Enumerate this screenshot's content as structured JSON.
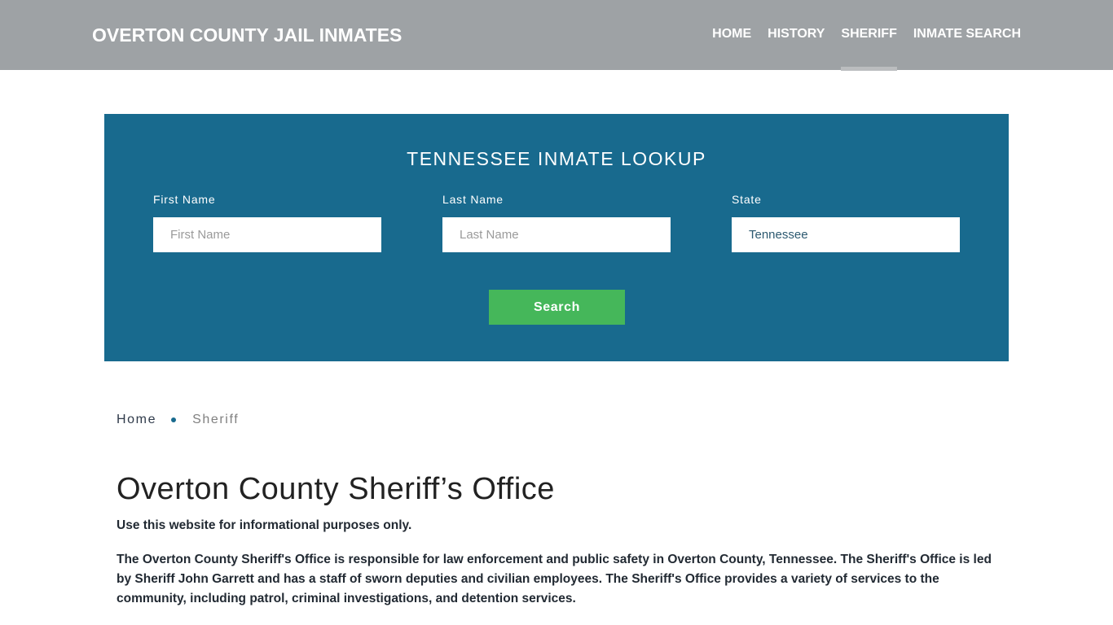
{
  "header": {
    "brand": "OVERTON COUNTY JAIL INMATES",
    "nav": [
      {
        "label": "HOME",
        "active": false
      },
      {
        "label": "HISTORY",
        "active": false
      },
      {
        "label": "SHERIFF",
        "active": true
      },
      {
        "label": "INMATE SEARCH",
        "active": false
      }
    ]
  },
  "lookup": {
    "title": "TENNESSEE INMATE LOOKUP",
    "first_name": {
      "label": "First Name",
      "placeholder": "First Name",
      "value": ""
    },
    "last_name": {
      "label": "Last Name",
      "placeholder": "Last Name",
      "value": ""
    },
    "state": {
      "label": "State",
      "value": "Tennessee"
    },
    "search_label": "Search",
    "colors": {
      "background": "#186a8e",
      "button": "#45b75a"
    }
  },
  "breadcrumb": {
    "items": [
      {
        "label": "Home"
      },
      {
        "label": "Sheriff"
      }
    ]
  },
  "main": {
    "title": "Overton County Sheriff’s Office",
    "lead": "Use this website for informational purposes only.",
    "paragraph": "The Overton County Sheriff's Office is responsible for law enforcement and public safety in Overton County, Tennessee. The Sheriff's Office is led by Sheriff John Garrett and has a staff of sworn deputies and civilian employees. The Sheriff's Office provides a variety of services to the community, including patrol, criminal investigations, and detention services."
  }
}
